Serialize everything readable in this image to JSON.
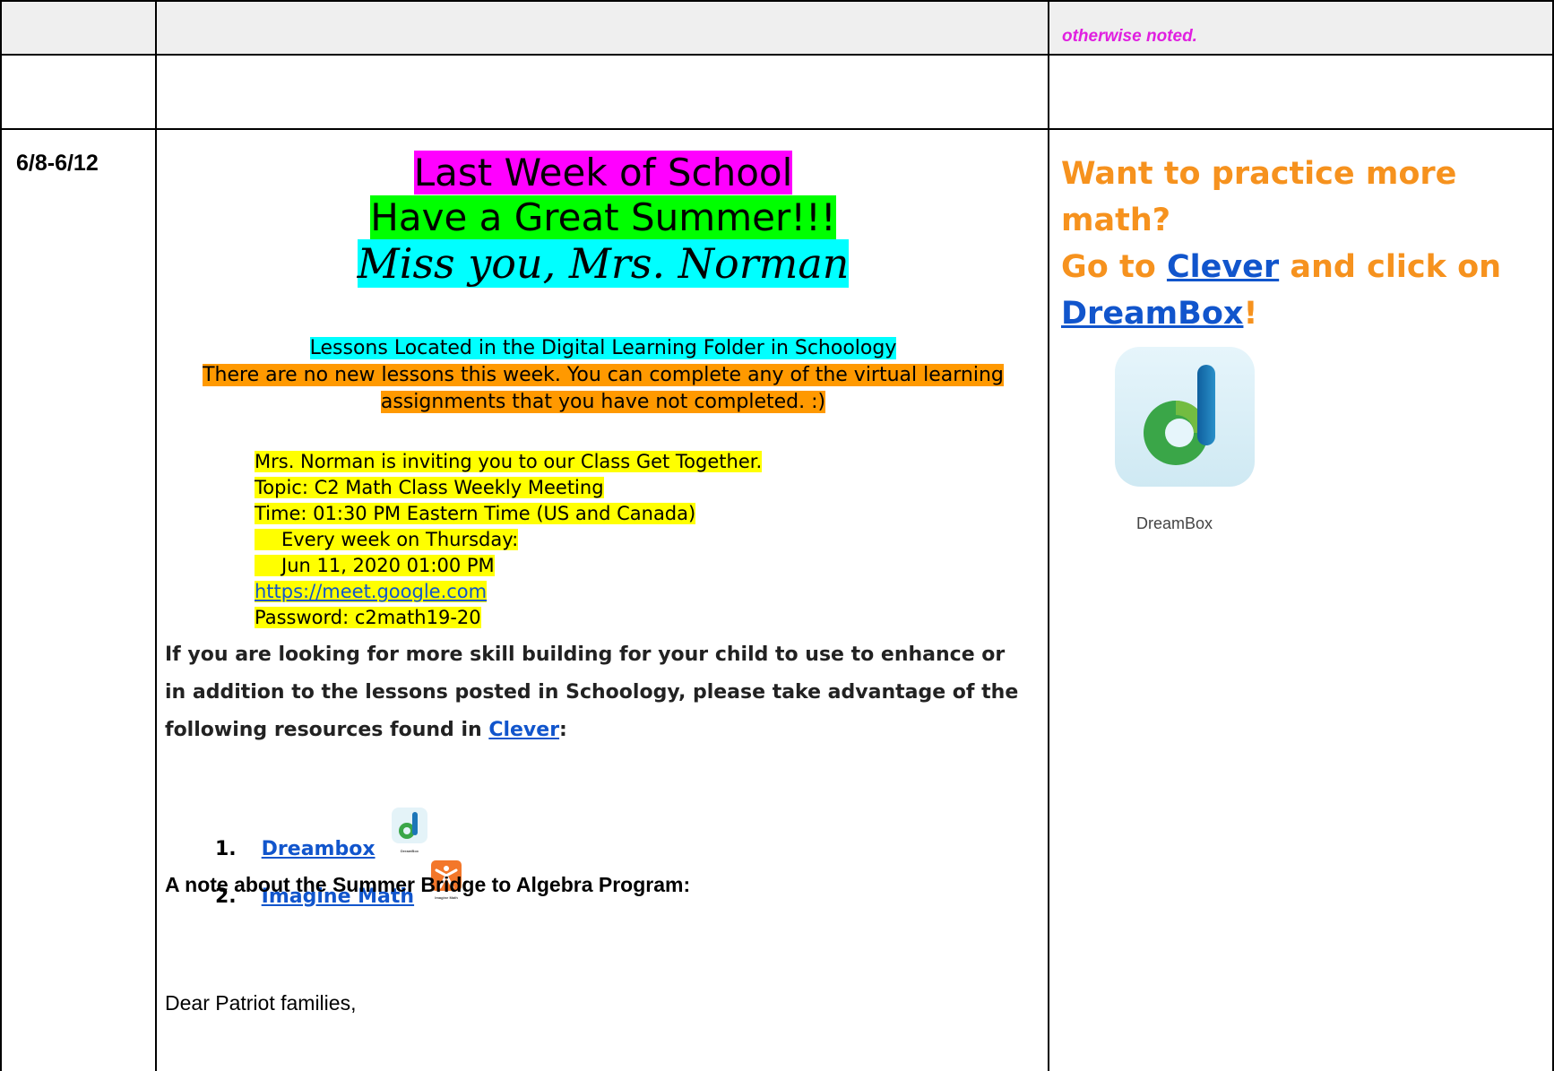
{
  "header": {
    "note": "otherwise noted."
  },
  "row": {
    "date": "6/8-6/12",
    "title_line1": "Last Week of School",
    "title_line2": "Have a Great Summer!!!",
    "title_line3": "Miss you, Mrs. Norman",
    "lessons_line1": "Lessons Located in the Digital Learning Folder in Schoology",
    "lessons_line2a": "There are no new lessons this week. You can complete any of the virtual learning",
    "lessons_line2b": "assignments that you have not completed. :)"
  },
  "meeting": {
    "invite": "Mrs. Norman is inviting you to our Class Get Together.",
    "topic": "Topic: C2 Math Class Weekly Meeting",
    "time": "Time: 01:30 PM Eastern Time (US and Canada)",
    "recurrence": "Every week on Thursday:",
    "date": "Jun 11, 2020 01:00 PM",
    "link": "https://meet.google.com",
    "password": "Password: c2math19-20"
  },
  "resources": {
    "intro": "If you are looking for more skill building for your child to use to enhance or in addition to the lessons posted in Schoology, please take advantage of the following resources found in",
    "clever_link": "Clever",
    "colon": ":",
    "items": [
      {
        "num": "1.",
        "label": "Dreambox",
        "icon_caption": "DreamBox"
      },
      {
        "num": "2.",
        "label": "Imagine Math",
        "icon_caption": "Imagine Math"
      }
    ]
  },
  "bridge": {
    "heading": "A note about the Summer Bridge to Algebra Program:",
    "greeting": "Dear Patriot families,"
  },
  "sidebar": {
    "line1": "Want to practice more math?",
    "go_to": "Go to",
    "clever_link": "Clever",
    "and_click": "and click on",
    "dreambox_link": "DreamBox",
    "excl": "!",
    "icon_caption": "DreamBox"
  },
  "colors": {
    "magenta": "#ff00ff",
    "green": "#00ff00",
    "cyan": "#00ffff",
    "orange": "#ff9900",
    "yellow": "#ffff00",
    "link": "#1155cc",
    "sidebar_text": "#f6921e"
  }
}
